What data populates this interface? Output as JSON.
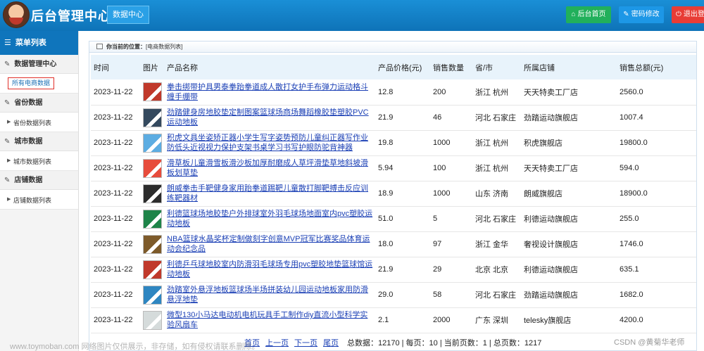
{
  "header": {
    "title": "后台管理中心",
    "nav_tab": "数据中心",
    "btn_home": "后台首页",
    "btn_password": "密码修改",
    "btn_logout": "退出登录"
  },
  "sidebar": {
    "menu_title": "菜单列表",
    "groups": [
      {
        "label": "数据管理中心",
        "items": [
          {
            "label": "所有电商数据",
            "active": true
          }
        ]
      },
      {
        "label": "省份数据",
        "items": [
          {
            "label": "省份数据列表"
          }
        ]
      },
      {
        "label": "城市数据",
        "items": [
          {
            "label": "城市数据列表"
          }
        ]
      },
      {
        "label": "店铺数据",
        "items": [
          {
            "label": "店铺数据列表"
          }
        ]
      }
    ]
  },
  "breadcrumb": {
    "prefix": "你当前的位置：",
    "location": "[电商数据列表]"
  },
  "table": {
    "headers": [
      "时间",
      "图片",
      "产品名称",
      "产品价格(元)",
      "销售数量",
      "省/市",
      "所属店铺",
      "销售总额(元)"
    ],
    "rows": [
      {
        "time": "2023-11-22",
        "name": "拳击绑带护具男泰拳跆拳道成人散打女护手布弹力运动格斗缠手绷带",
        "price": "12.8",
        "qty": "200",
        "region": "浙江 杭州",
        "shop": "天天特卖工厂店",
        "total": "2560.0",
        "thumb": "#c0392b"
      },
      {
        "time": "2023-11-22",
        "name": "劲踏健身房地胶垫定制图案篮球场商场舞蹈橡胶垫塑胶PVC运动地板",
        "price": "21.9",
        "qty": "46",
        "region": "河北 石家庄",
        "shop": "劲踏运动旗舰店",
        "total": "1007.4",
        "thumb": "#34495e"
      },
      {
        "time": "2023-11-22",
        "name": "积虎文具坐姿矫正器小学生写字姿势预防儿童纠正器写作业防低头近视视力保护支架书桌学习书写护眼防驼背神器",
        "price": "19.8",
        "qty": "1000",
        "region": "浙江 杭州",
        "shop": "积虎旗舰店",
        "total": "19800.0",
        "thumb": "#5dade2"
      },
      {
        "time": "2023-11-22",
        "name": "滑草板儿童滑雪板滑沙板加厚耐磨成人草坪滑垫草地斜坡滑板划草垫",
        "price": "5.94",
        "qty": "100",
        "region": "浙江 杭州",
        "shop": "天天特卖工厂店",
        "total": "594.0",
        "thumb": "#e74c3c"
      },
      {
        "time": "2023-11-22",
        "name": "朗威拳击手靶健身家用跆拳道踢靶儿童散打脚靶搏击反应训练靶器材",
        "price": "18.9",
        "qty": "1000",
        "region": "山东 济南",
        "shop": "朗威旗舰店",
        "total": "18900.0",
        "thumb": "#2c2c2c"
      },
      {
        "time": "2023-11-22",
        "name": "利德篮球场地胶垫户外排球室外羽毛球场地面室内pvc塑胶运动地板",
        "price": "51.0",
        "qty": "5",
        "region": "河北 石家庄",
        "shop": "利德运动旗舰店",
        "total": "255.0",
        "thumb": "#1e8449"
      },
      {
        "time": "2023-11-22",
        "name": "NBA篮球水晶奖杯定制做刻字创意MVP冠军比赛奖品体育运动会纪念品",
        "price": "18.0",
        "qty": "97",
        "region": "浙江 金华",
        "shop": "奢视设计旗舰店",
        "total": "1746.0",
        "thumb": "#7d5a2a"
      },
      {
        "time": "2023-11-22",
        "name": "利德乒乓球地胶室内防滑羽毛球场专用pvc塑胶地垫篮球馆运动地板",
        "price": "21.9",
        "qty": "29",
        "region": "北京 北京",
        "shop": "利德运动旗舰店",
        "total": "635.1",
        "thumb": "#c0392b"
      },
      {
        "time": "2023-11-22",
        "name": "劲踏室外悬浮地板篮球场半场拼装幼儿园运动地板家用防滑悬浮地垫",
        "price": "29.0",
        "qty": "58",
        "region": "河北 石家庄",
        "shop": "劲踏运动旗舰店",
        "total": "1682.0",
        "thumb": "#2e86c1"
      },
      {
        "time": "2023-11-22",
        "name": "微型130小马达电动机电机玩具手工制作diy直流小型科学实验风扇车",
        "price": "2.1",
        "qty": "2000",
        "region": "广东 深圳",
        "shop": "telesky旗舰店",
        "total": "4200.0",
        "thumb": "#d5dbdb"
      }
    ]
  },
  "pager": {
    "first": "首页",
    "prev": "上一页",
    "next": "下一页",
    "last": "尾页",
    "summary": "总数据：12170 | 每页：10 | 当前页数：1 | 总页数：1217"
  },
  "watermark": {
    "left": "www.toymoban.com 网络图片仅供展示，非存储，如有侵权请联系删除。",
    "right": "CSDN @黄菊华老师"
  }
}
